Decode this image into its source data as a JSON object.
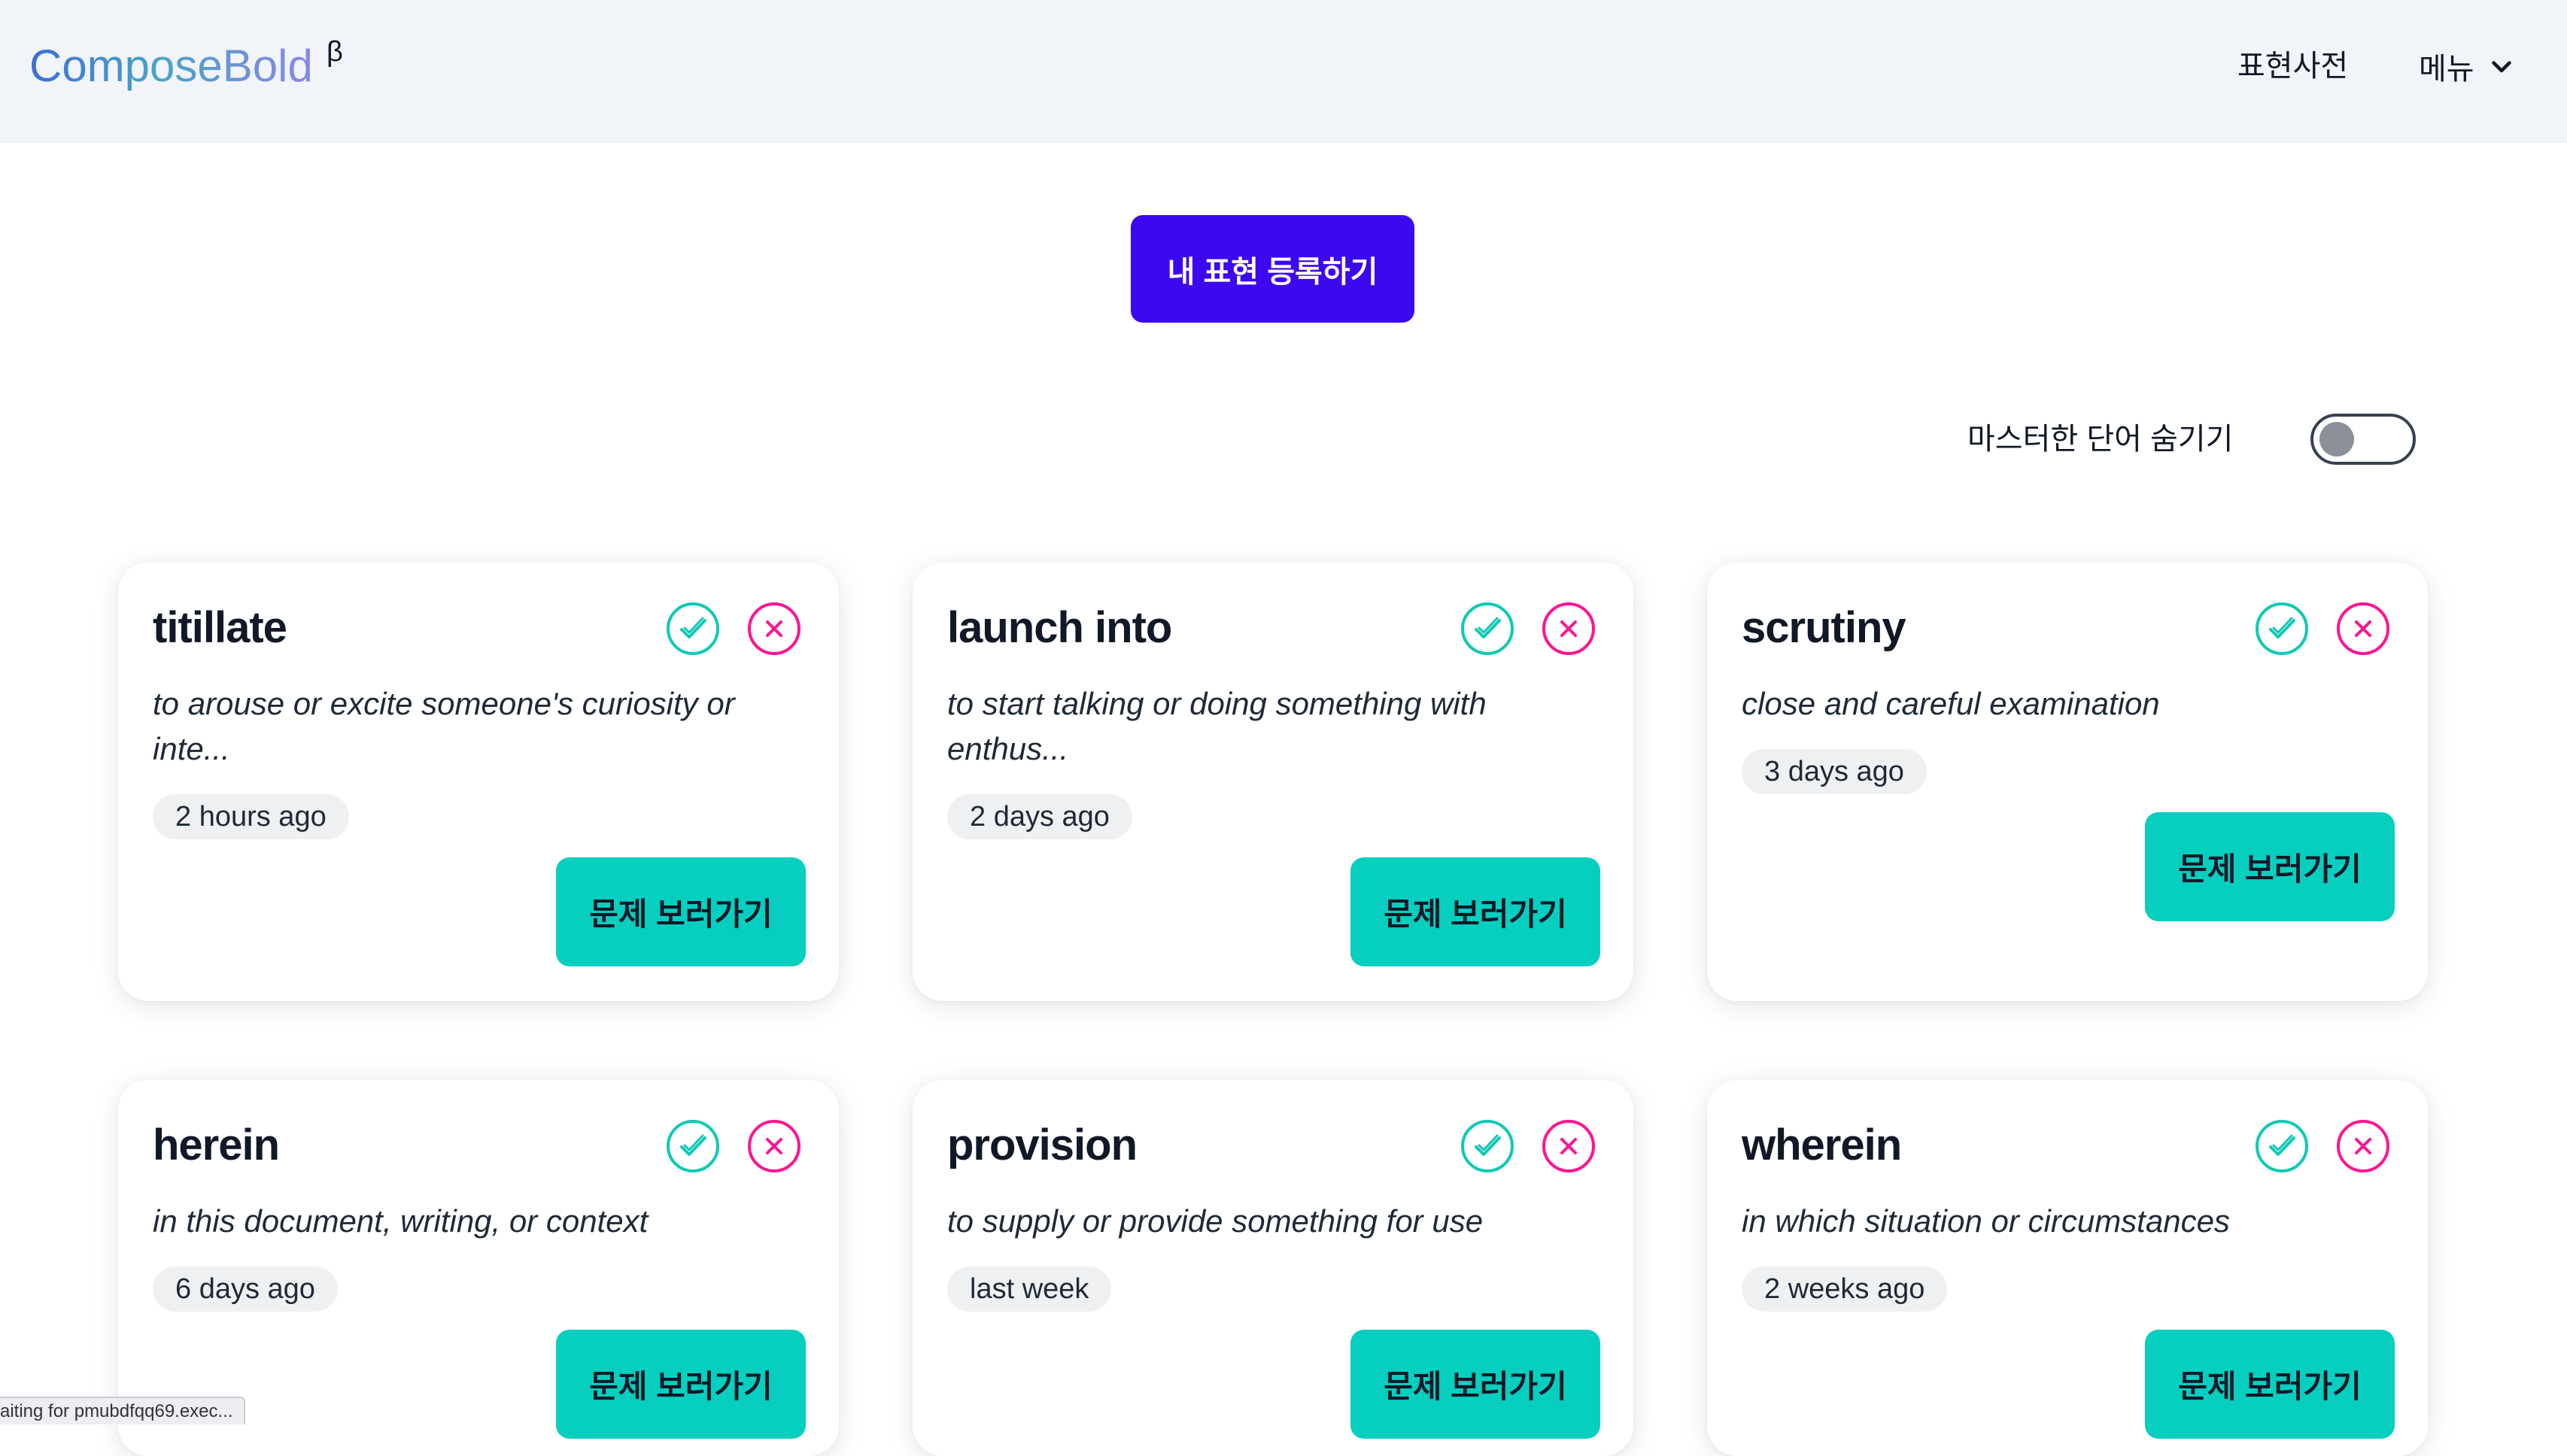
{
  "header": {
    "logo": "ComposeBold",
    "beta": "β",
    "nav_dictionary": "표현사전",
    "nav_menu": "메뉴"
  },
  "register_button": "내 표현 등록하기",
  "toggle": {
    "label": "마스터한 단어 숨기기",
    "on": false
  },
  "cards": [
    {
      "word": "titillate",
      "definition": "to arouse or excite someone's curiosity or inte...",
      "time": "2 hours ago",
      "button": "문제 보러가기"
    },
    {
      "word": "launch into",
      "definition": "to start talking or doing something with enthus...",
      "time": "2 days ago",
      "button": "문제 보러가기"
    },
    {
      "word": "scrutiny",
      "definition": "close and careful examination",
      "time": "3 days ago",
      "button": "문제 보러가기"
    },
    {
      "word": "herein",
      "definition": "in this document, writing, or context",
      "time": "6 days ago",
      "button": "문제 보러가기"
    },
    {
      "word": "provision",
      "definition": "to supply or provide something for use",
      "time": "last week",
      "button": "문제 보러가기"
    },
    {
      "word": "wherein",
      "definition": "in which situation or circumstances",
      "time": "2 weeks ago",
      "button": "문제 보러가기"
    }
  ],
  "status_bar": "aiting for pmubdfqq69.exec...",
  "colors": {
    "header_bg": "#f1f4f9",
    "primary_button": "#3d07f0",
    "quiz_button": "#06cfbf",
    "check_icon": "#10c9b5",
    "x_icon": "#ff1493"
  }
}
